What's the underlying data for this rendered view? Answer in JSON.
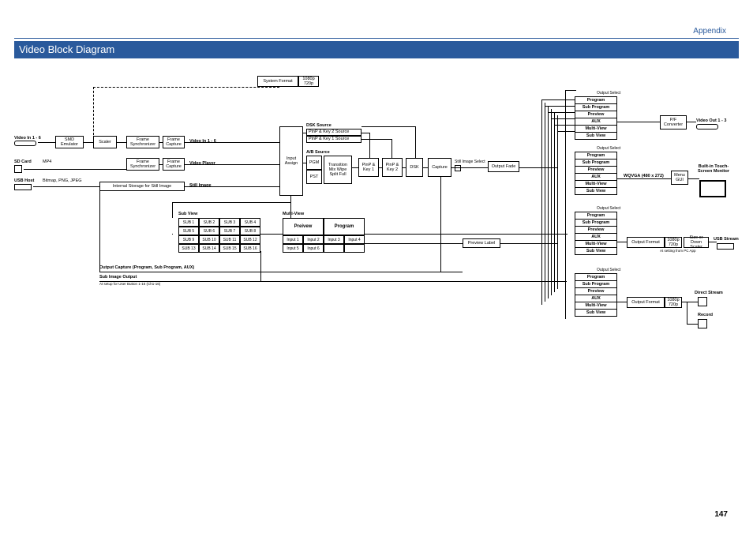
{
  "header": {
    "section": "Appendix"
  },
  "title": "Video Block Diagram",
  "page": "147",
  "inputs": {
    "video_in": "Video In 1 - 6",
    "sd": "SD Card",
    "sd_fmt": "MP4",
    "usb": "USB Host",
    "usb_fmt": "Bitmap, PNG, JPEG"
  },
  "in_blocks": {
    "smd": "SMD\nEmulator",
    "scaler": "Scaler",
    "fs1": "Frame\nSynchronizer",
    "fc1": "Frame\nCapture",
    "fs2": "Frame\nSynchronizer",
    "fc2": "Frame\nCapture",
    "video_16": "Video In 1 - 6",
    "video_player": "Video Player",
    "storage": "Internal Storage for Still Image",
    "still": "Still Image"
  },
  "sysfmt": {
    "label": "System Format",
    "opts": "1080p\n720p"
  },
  "assign": "Input\nAssign",
  "dsk": {
    "title": "DSK Source",
    "l1": "PinP & Key 2 Source",
    "l2": "PinP & Key 1 Source"
  },
  "ab": {
    "title": "A/B Source",
    "pgm": "PGM",
    "pst": "PST",
    "trans": "Transition\nMix\nWipe\nSplit\nFull"
  },
  "pipe": {
    "pk1": "PinP &\nKey 1",
    "pk2": "PinP &\nKey 2",
    "dsk": "DSK",
    "cap": "Capture",
    "stillsel": "Still Image Select",
    "fade": "Output Fade"
  },
  "subview": {
    "title": "Sub View",
    "cells": [
      "SUB 1",
      "SUB 2",
      "SUB 3",
      "SUB 4",
      "SUB 5",
      "SUB 6",
      "SUB 7",
      "SUB 8",
      "SUB 9",
      "SUB 10",
      "SUB 11",
      "SUB 12",
      "SUB 13",
      "SUB 14",
      "SUB 15",
      "SUB 16"
    ]
  },
  "multiview": {
    "title": "Multi-View",
    "pv": "Preivew",
    "pg": "Program",
    "cells": [
      "Input 1",
      "Input 2",
      "Input 3",
      "Input 4",
      "Input 5",
      "Input 6"
    ]
  },
  "pvlabel": "Preview Label",
  "osel": {
    "title": "Output Select",
    "items": [
      "Program",
      "Sub Program",
      "Preview",
      "AUX",
      "Multi-View",
      "Sub View"
    ]
  },
  "out1": {
    "pf": "P/F\nConverter",
    "label": "Video Out 1 - 3"
  },
  "out2": {
    "wqvga": "WQVGA (480 x 272)",
    "menu": "Menu\nGUI",
    "builtin": "Built-in\nTouch-Screen\nMonitor"
  },
  "out3": {
    "of": "Output Format",
    "opts": "1080p\n720p",
    "side": "Size or\nDown Scaler",
    "note": "At setting from PC App",
    "usb": "USB Stream"
  },
  "out4": {
    "of": "Output Format",
    "opts": "1080p\n720p",
    "direct": "Direct Stream",
    "rec": "Record"
  },
  "bottom": {
    "l1": "Output Capture (Program, Sub Program, AUX)",
    "l2": "Sub Image Output",
    "note": "At setup for User Button 1-16 (Ch1-16)"
  }
}
